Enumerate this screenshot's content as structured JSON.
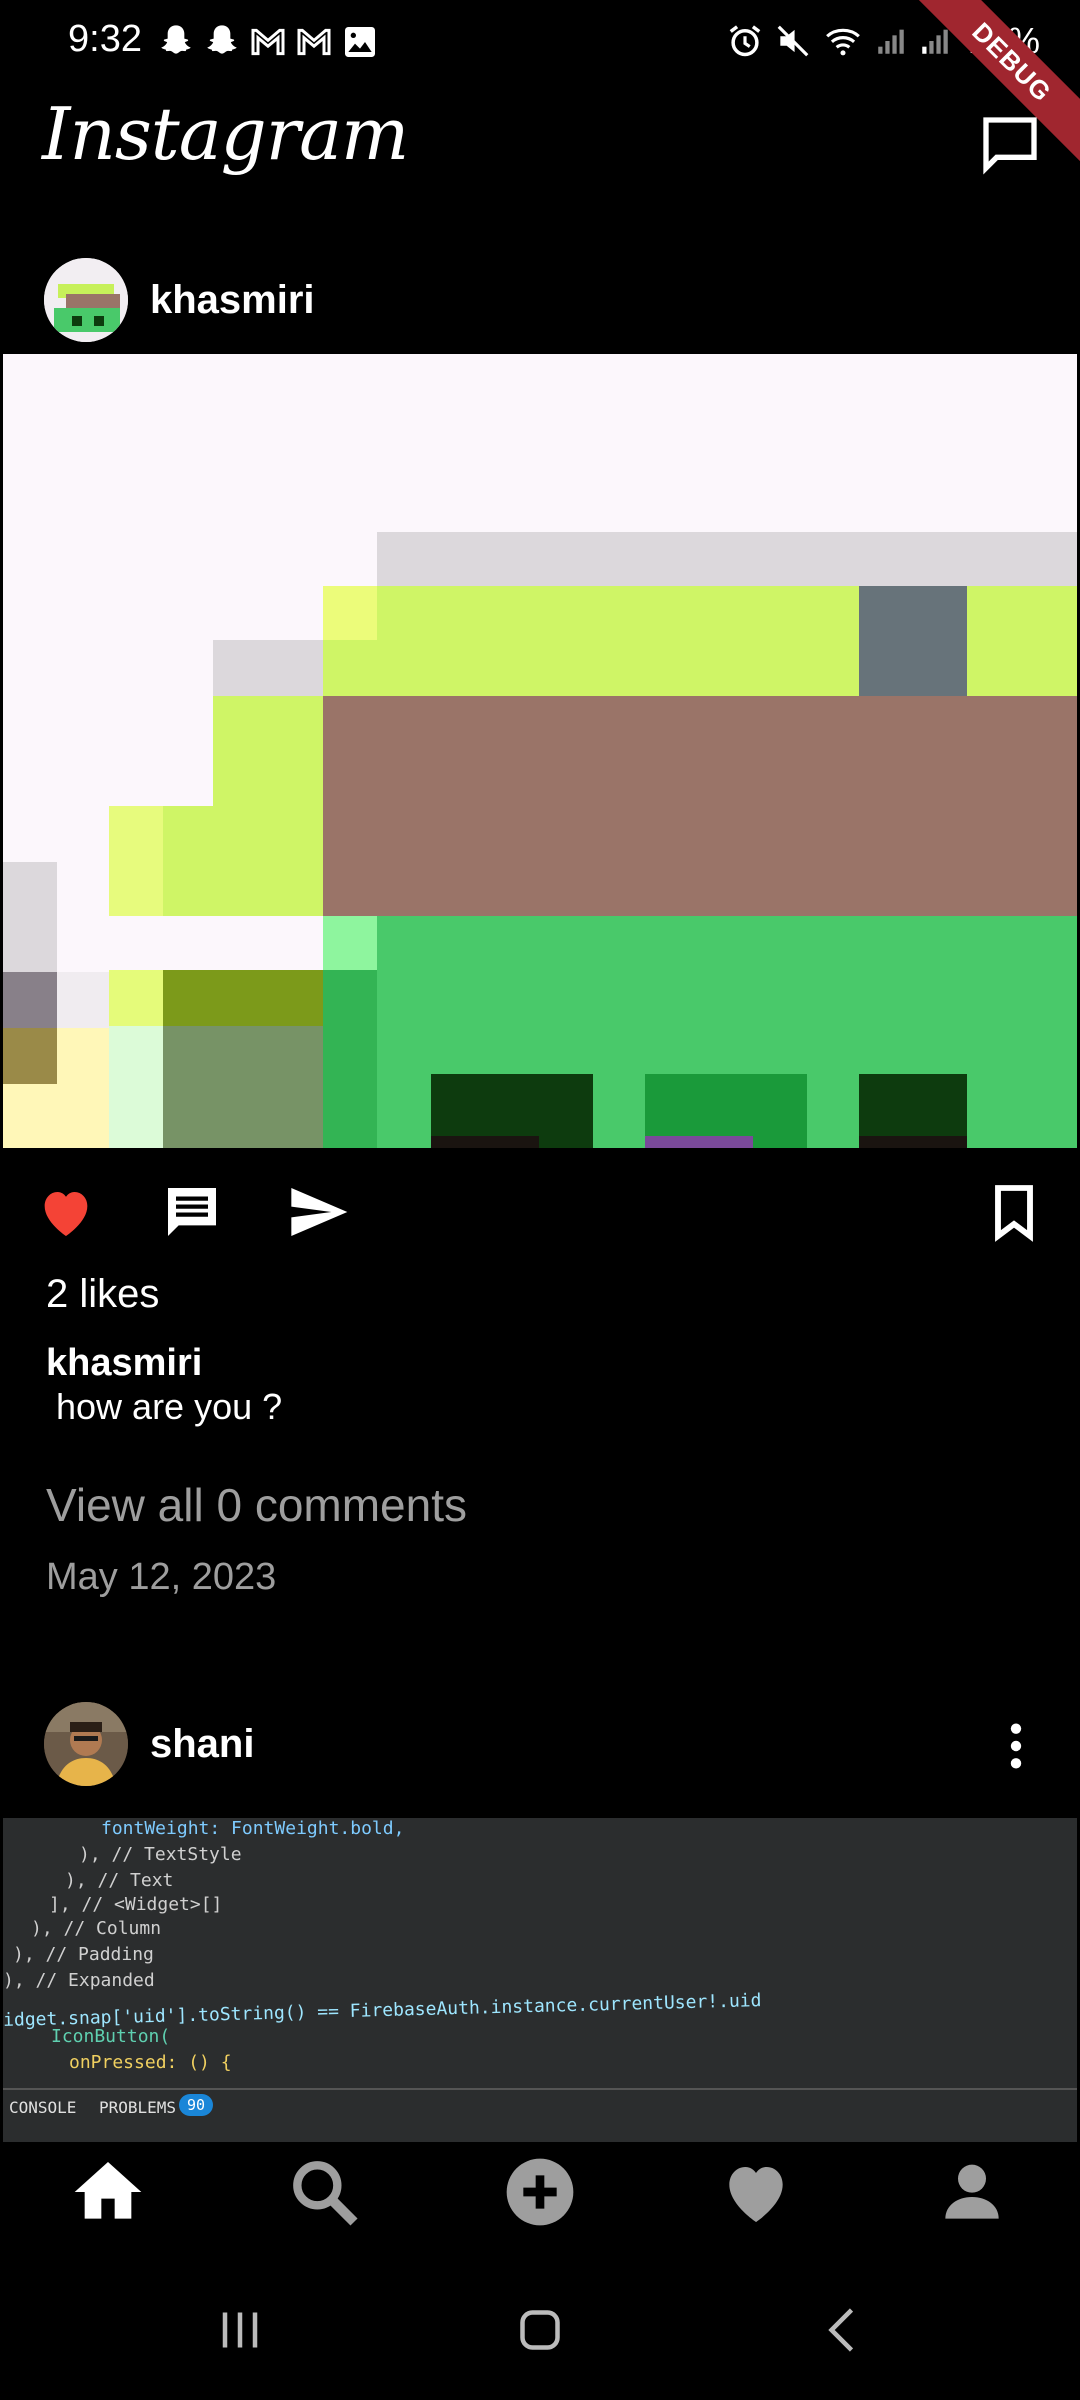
{
  "status_bar": {
    "time": "9:32",
    "battery": "14%",
    "notification_icons": [
      "snapchat-icon",
      "snapchat-icon",
      "gmail-icon",
      "gmail-icon",
      "gallery-icon"
    ],
    "system_icons": [
      "alarm-icon",
      "mute-icon",
      "wifi-icon",
      "signal-icon",
      "signal-icon"
    ]
  },
  "debug_banner": "DEBUG",
  "app_bar": {
    "title": "Instagram",
    "message_icon": "chat-bubble-icon"
  },
  "posts": [
    {
      "username": "khasmiri",
      "likes": "2 likes",
      "caption_user": "khasmiri",
      "caption": " how are you ?",
      "view_comments": "View all 0 comments",
      "date": "May 12, 2023",
      "liked": true
    },
    {
      "username": "shani",
      "more_icon": "more-vert-icon",
      "code_snippet": [
        "fontWeight: FontWeight.bold,",
        "), // TextStyle",
        "), // Text",
        "], // <Widget>[]",
        "), // Column",
        "), // Padding",
        "), // Expanded",
        "idget.snap['uid'].toString() == FirebaseAuth.instance.currentUser!.uid",
        "IconButton(",
        "onPressed: () {",
        "CONSOLE",
        "PROBLEMS",
        "90"
      ]
    }
  ],
  "bottom_nav": [
    "home-icon",
    "search-icon",
    "add-icon",
    "heart-icon",
    "person-icon"
  ],
  "colors": {
    "background": "#000000",
    "like_red": "#f44336",
    "secondary_text": "#9e9e9e"
  }
}
